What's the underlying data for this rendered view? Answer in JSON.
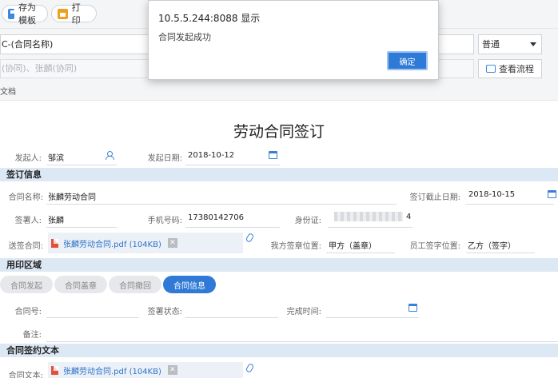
{
  "toolbar": {
    "save_template": "存为模板",
    "print": "打印"
  },
  "header": {
    "contract_name_value": "C-(合同名称)",
    "priority_value": "普通",
    "approvers_value": "(协同)、张麟(协同)",
    "view_flow": "查看流程",
    "doc_label": "文档"
  },
  "dialog": {
    "title": "10.5.5.244:8088 显示",
    "message": "合同发起成功",
    "ok": "确定"
  },
  "page_title": "劳动合同签订",
  "initiator": {
    "label": "发起人:",
    "value": "邹滨",
    "date_label": "发起日期:",
    "date_value": "2018-10-12"
  },
  "sign_info": {
    "section": "签订信息",
    "contract_name_label": "合同名称:",
    "contract_name_value": "张麟劳动合同",
    "deadline_label": "签订截止日期:",
    "deadline_value": "2018-10-15",
    "signer_label": "签署人:",
    "signer_value": "张麟",
    "phone_label": "手机号码:",
    "phone_value": "17380142706",
    "id_label": "身份证:",
    "id_value_tail": "4",
    "contract_file_label": "送签合同:",
    "contract_file": "张麟劳动合同.pdf (104KB)",
    "our_seal_label": "我方签章位置:",
    "our_seal_value": "甲方（盖章）",
    "employee_sign_label": "员工签字位置:",
    "employee_sign_value": "乙方（签字）"
  },
  "seal_area": {
    "section": "用印区域",
    "tabs": [
      {
        "label": "合同发起"
      },
      {
        "label": "合同盖章"
      },
      {
        "label": "合同撤回"
      },
      {
        "label": "合同信息"
      }
    ],
    "contract_no_label": "合同号:",
    "sign_status_label": "签署状态:",
    "complete_time_label": "完成时间:",
    "remark_label": "备注:"
  },
  "contract_text": {
    "section": "合同签约文本",
    "label": "合同文本:",
    "file": "张麟劳动合同.pdf (104KB)"
  }
}
